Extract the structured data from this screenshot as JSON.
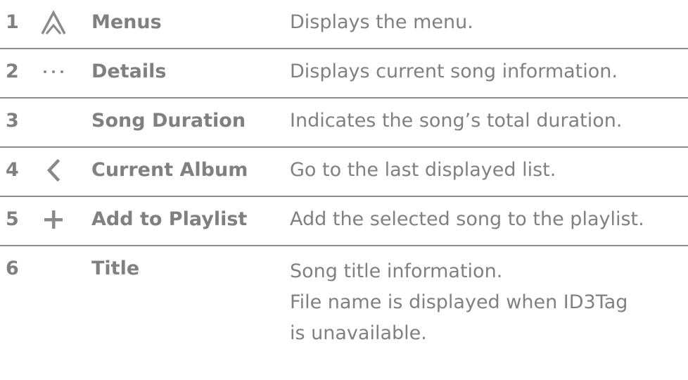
{
  "rows": [
    {
      "number": "1",
      "icon": "a-logo-icon",
      "name": "Menus",
      "description": "Displays the menu."
    },
    {
      "number": "2",
      "icon": "more-dots-icon",
      "name": "Details",
      "description": "Displays current song information."
    },
    {
      "number": "3",
      "icon": "",
      "name": "Song Duration",
      "description": "Indicates the song’s total duration."
    },
    {
      "number": "4",
      "icon": "chevron-left-icon",
      "name": "Current Album",
      "description": "Go to the last displayed list."
    },
    {
      "number": "5",
      "icon": "plus-icon",
      "name": "Add to Playlist",
      "description": "Add the selected song to the playlist."
    },
    {
      "number": "6",
      "icon": "",
      "name": "Title",
      "description_lines": [
        "Song title information.",
        "File name is displayed when ID3Tag",
        "is unavailable."
      ]
    }
  ]
}
